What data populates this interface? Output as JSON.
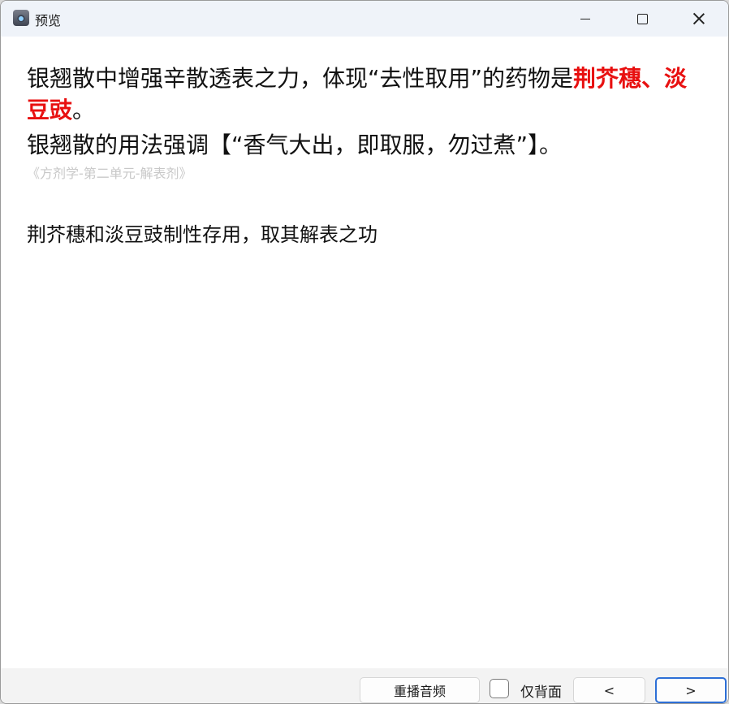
{
  "window": {
    "title": "预览"
  },
  "card": {
    "question_line1_text": "银翘散中增强辛散透表之力，体现“去性取用”的药物是",
    "question_line1_highlight": "荆芥穗、淡豆豉",
    "question_line1_end": "。",
    "question_line2": "银翘散的用法强调【“香气大出，即取服，勿过煮”】。",
    "source": "《方剂学-第二单元-解表剂》",
    "answer": "荆芥穗和淡豆豉制性存用，取其解表之功"
  },
  "footer": {
    "replay_label": "重播音频",
    "back_only_label": "仅背面",
    "back_only_checked": false,
    "prev_label": "<",
    "next_label": ">"
  },
  "colors": {
    "highlight": "#e81010",
    "titlebar": "#eff3f9",
    "next_border": "#2d6fd6"
  }
}
